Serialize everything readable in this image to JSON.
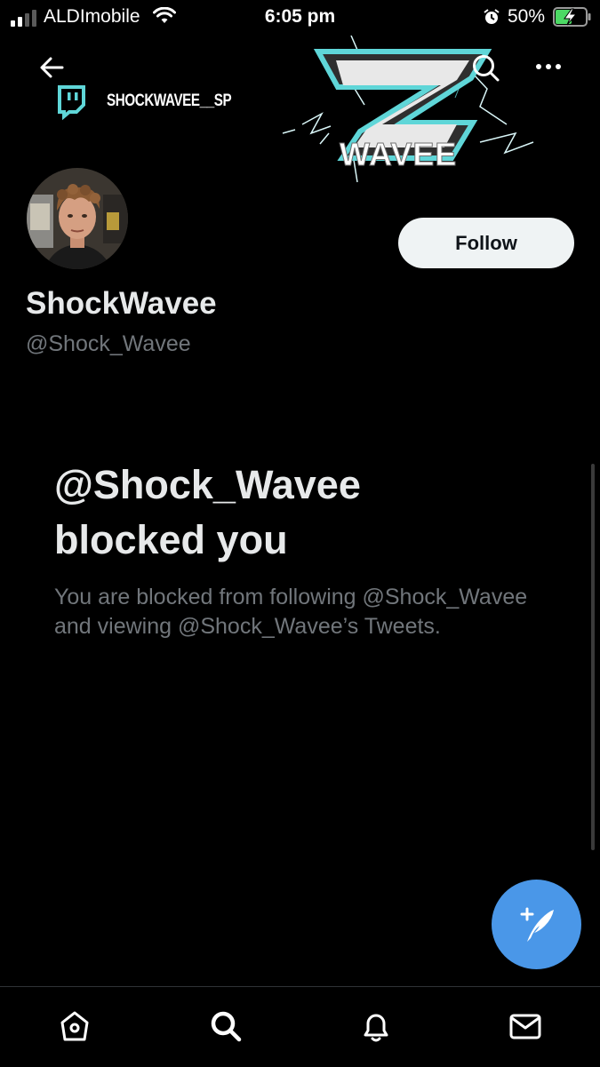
{
  "status_bar": {
    "carrier": "ALDImobile",
    "time": "6:05 pm",
    "battery_percent": "50%"
  },
  "banner": {
    "twitch_handle": "SHOCKWAVEE__SP",
    "logo_text": "WAVEE",
    "accent_color": "#5fd6d8"
  },
  "profile": {
    "display_name": "ShockWavee",
    "handle": "@Shock_Wavee",
    "follow_label": "Follow"
  },
  "blocked": {
    "title_line1": "@Shock_Wavee",
    "title_line2": "blocked you",
    "message": "You are blocked from following @Shock_Wavee and viewing @Shock_Wavee’s Tweets."
  },
  "icons": {
    "back": "arrow-left-icon",
    "search": "search-icon",
    "more": "more-icon",
    "compose": "compose-tweet-icon",
    "tabs": [
      "home-icon",
      "search-icon",
      "notifications-icon",
      "messages-icon"
    ]
  },
  "colors": {
    "background": "#000000",
    "fab": "#4a97e8",
    "follow_bg": "#eff3f4",
    "muted_text": "#71767b"
  }
}
